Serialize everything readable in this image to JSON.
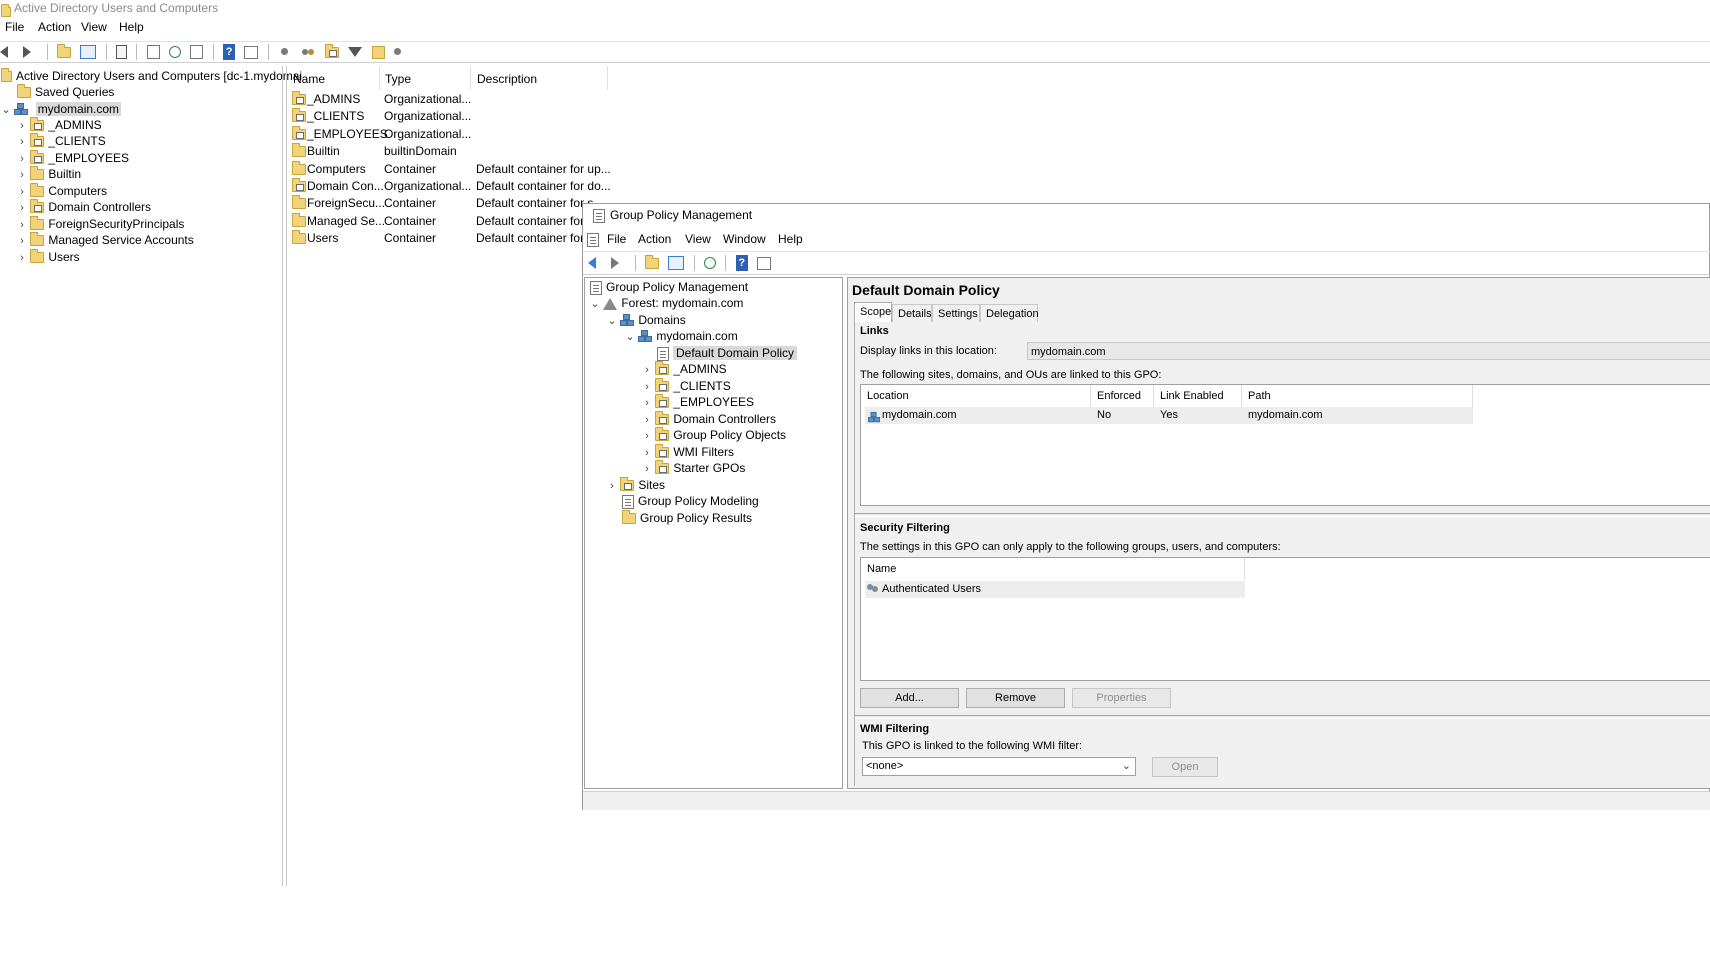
{
  "ad": {
    "title": "Active Directory Users and Computers",
    "menu": [
      "File",
      "Action",
      "View",
      "Help"
    ],
    "tree": {
      "root": "Active Directory Users and Computers [dc-1.mydomai",
      "saved_queries": "Saved Queries",
      "domain": "mydomain.com",
      "children": [
        "_ADMINS",
        "_CLIENTS",
        "_EMPLOYEES",
        "Builtin",
        "Computers",
        "Domain Controllers",
        "ForeignSecurityPrincipals",
        "Managed Service Accounts",
        "Users"
      ]
    },
    "list": {
      "headers": [
        "Name",
        "Type",
        "Description"
      ],
      "rows": [
        {
          "name": "_ADMINS",
          "type": "Organizational...",
          "desc": ""
        },
        {
          "name": "_CLIENTS",
          "type": "Organizational...",
          "desc": ""
        },
        {
          "name": "_EMPLOYEES",
          "type": "Organizational...",
          "desc": ""
        },
        {
          "name": "Builtin",
          "type": "builtinDomain",
          "desc": ""
        },
        {
          "name": "Computers",
          "type": "Container",
          "desc": "Default container for up..."
        },
        {
          "name": "Domain Con...",
          "type": "Organizational...",
          "desc": "Default container for do..."
        },
        {
          "name": "ForeignSecu...",
          "type": "Container",
          "desc": "Default container for s"
        },
        {
          "name": "Managed Se...",
          "type": "Container",
          "desc": "Default container for r"
        },
        {
          "name": "Users",
          "type": "Container",
          "desc": "Default container for u"
        }
      ]
    }
  },
  "gpm": {
    "title": "Group Policy Management",
    "menu": [
      "File",
      "Action",
      "View",
      "Window",
      "Help"
    ],
    "tree": {
      "root": "Group Policy Management",
      "forest": "Forest: mydomain.com",
      "domains": "Domains",
      "domain": "mydomain.com",
      "selected": "Default Domain Policy",
      "domain_children": [
        "_ADMINS",
        "_CLIENTS",
        "_EMPLOYEES",
        "Domain Controllers",
        "Group Policy Objects",
        "WMI Filters",
        "Starter GPOs"
      ],
      "sites": "Sites",
      "modeling": "Group Policy Modeling",
      "results": "Group Policy Results"
    },
    "detail": {
      "heading": "Default Domain Policy",
      "tabs": [
        "Scope",
        "Details",
        "Settings",
        "Delegation"
      ],
      "links_title": "Links",
      "display_links_label": "Display links in this location:",
      "display_links_value": "mydomain.com",
      "linked_text": "The following sites, domains, and OUs are linked to this GPO:",
      "links_headers": [
        "Location",
        "Enforced",
        "Link Enabled",
        "Path"
      ],
      "links_rows": [
        {
          "location": "mydomain.com",
          "enforced": "No",
          "enabled": "Yes",
          "path": "mydomain.com"
        }
      ],
      "security_title": "Security Filtering",
      "security_text": "The settings in this GPO can only apply to the following groups, users, and computers:",
      "security_header": "Name",
      "security_rows": [
        "Authenticated Users"
      ],
      "buttons": {
        "add": "Add...",
        "remove": "Remove",
        "properties": "Properties"
      },
      "wmi_title": "WMI Filtering",
      "wmi_text": "This GPO is linked to the following WMI filter:",
      "wmi_value": "<none>",
      "open": "Open"
    }
  },
  "colors": {
    "selection": "#cce8ff",
    "tree_select": "#d9d9d9",
    "accent": "#3a7bd5"
  }
}
